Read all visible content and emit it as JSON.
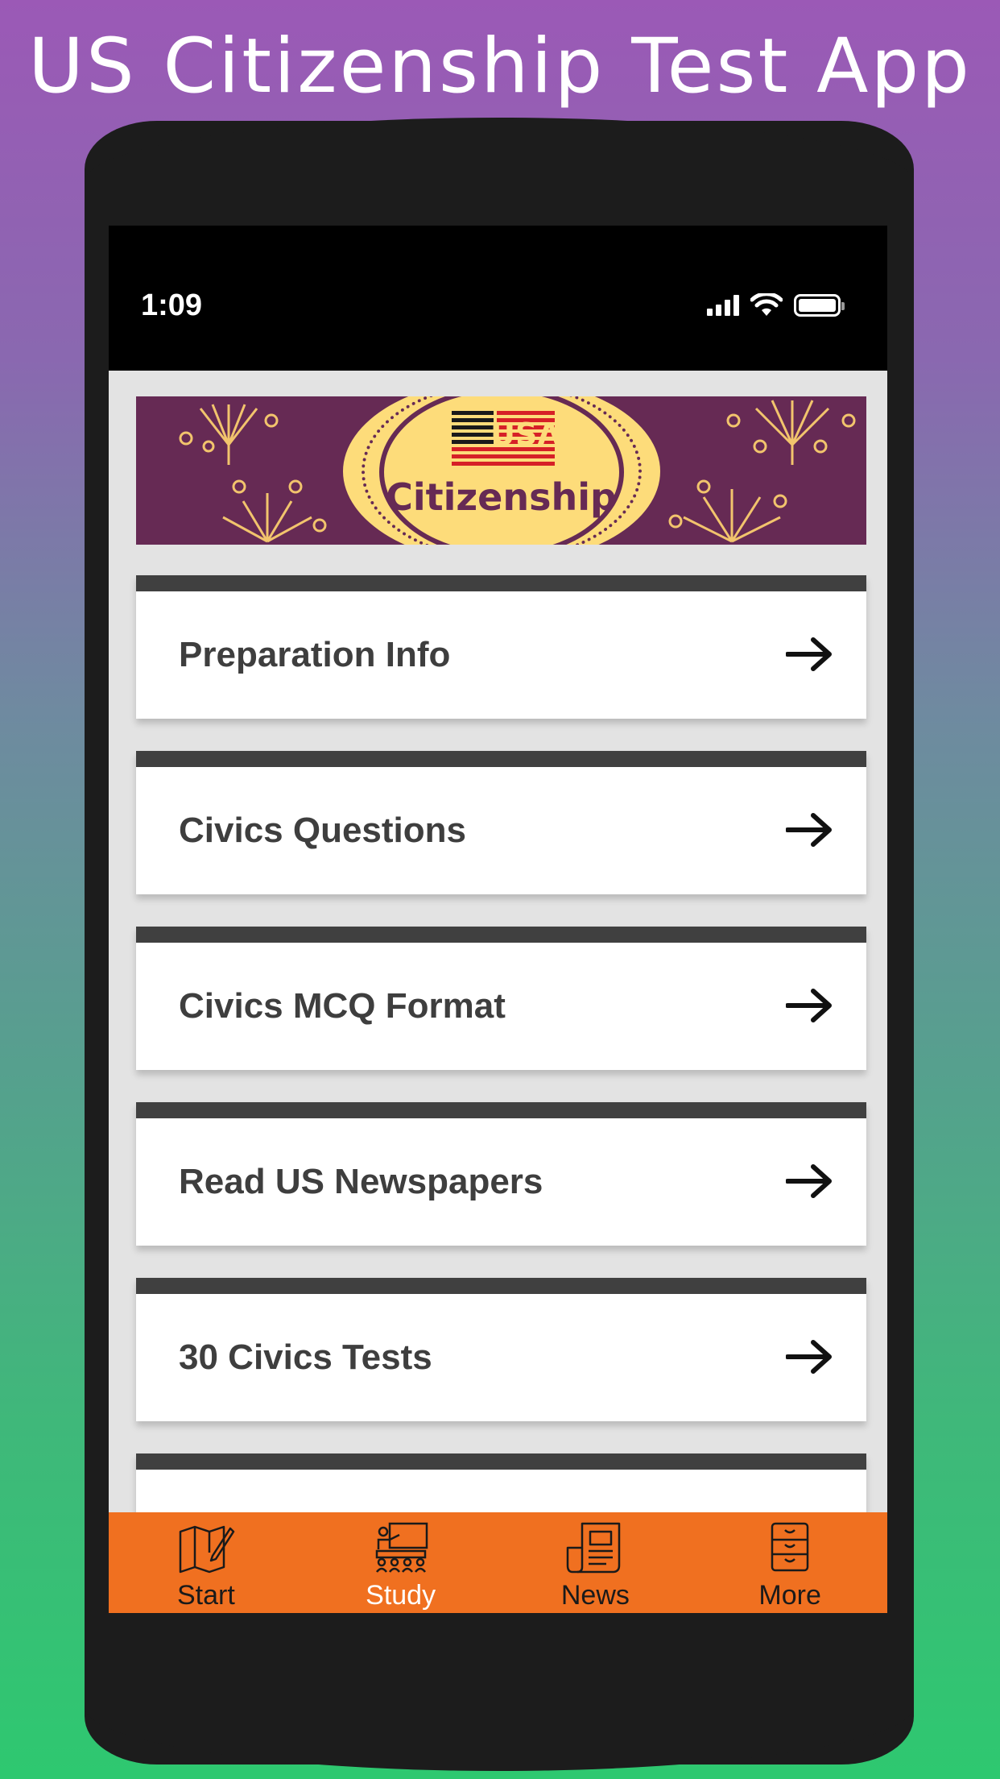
{
  "promo": {
    "title": "US Citizenship Test App"
  },
  "status_bar": {
    "time": "1:09",
    "icons": [
      "cellular-signal-icon",
      "wifi-icon",
      "battery-icon"
    ]
  },
  "banner": {
    "brand_text": "Citizenship",
    "flag_text": "USA"
  },
  "menu": {
    "items": [
      {
        "label": "Preparation Info",
        "icon": "arrow-right-icon"
      },
      {
        "label": "Civics Questions",
        "icon": "arrow-right-icon"
      },
      {
        "label": "Civics MCQ Format",
        "icon": "arrow-right-icon"
      },
      {
        "label": "Read US Newspapers",
        "icon": "arrow-right-icon"
      },
      {
        "label": "30 Civics Tests",
        "icon": "arrow-right-icon"
      },
      {
        "label": "",
        "icon": ""
      }
    ]
  },
  "tab_bar": {
    "active": "Study",
    "tabs": [
      {
        "label": "Start",
        "icon": "map-pencil-icon"
      },
      {
        "label": "Study",
        "icon": "classroom-teacher-icon"
      },
      {
        "label": "News",
        "icon": "newspaper-icon"
      },
      {
        "label": "More",
        "icon": "file-cabinet-icon"
      }
    ]
  },
  "colors": {
    "tab_bar_bg": "#f07020",
    "banner_bg": "#662a54",
    "banner_seal": "#fddc7a",
    "card_topbar": "#404040",
    "card_text": "#3e3e3e",
    "active_tab_text": "#ffffff"
  }
}
